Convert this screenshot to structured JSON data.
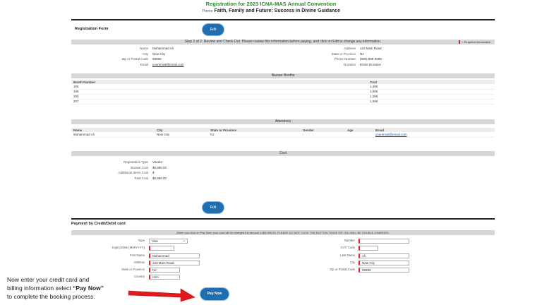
{
  "header": {
    "title": "Registration for 2023 ICNA-MAS Annual Convention",
    "theme_label": "Theme",
    "theme": "Faith, Family and Future: Success in Divine Guidance"
  },
  "form": {
    "title": "Registration Form",
    "edit_label": "Edit",
    "step_text": "Step 2 of 2: Review and Check Out. Please review this information before paying, and click on Edit to change any information.",
    "required_note": "= Required Information",
    "left": [
      {
        "k": "Name",
        "v": "Muhammad Ali"
      },
      {
        "k": "City",
        "v": "New City"
      },
      {
        "k": "Zip or Postal Code",
        "v": "99999"
      },
      {
        "k": "Email",
        "v": "youremail@email.com"
      }
    ],
    "right": [
      {
        "k": "Address",
        "v": "123 Main Road"
      },
      {
        "k": "State or Province",
        "v": "NJ"
      },
      {
        "k": "Phone Number",
        "v": "(999) 999-9999"
      },
      {
        "k": "Duration",
        "v": "Entire Duration"
      }
    ]
  },
  "bazaar": {
    "title": "Bazaar Booths",
    "col_booth": "Booth Number",
    "col_cost": "Cost",
    "rows": [
      {
        "booth": "105",
        "cost": "1,395"
      },
      {
        "booth": "106",
        "cost": "1,595"
      },
      {
        "booth": "205",
        "cost": "1,395"
      },
      {
        "booth": "207",
        "cost": "1,595"
      }
    ]
  },
  "attendees": {
    "title": "Attendees",
    "cols": [
      "Name",
      "City",
      "State or Province",
      "Gender",
      "Age",
      "Email"
    ],
    "rows": [
      {
        "name": "Muhammad Ali",
        "city": "New City",
        "state": "NJ",
        "gender": "",
        "age": "",
        "email": "youremail@email.com"
      }
    ]
  },
  "cost": {
    "title": "Cost",
    "items": [
      {
        "k": "Registration Type",
        "v": "Vendor"
      },
      {
        "k": "Bazaar Cost",
        "v": "$5,980.00"
      },
      {
        "k": "Additional Items Cost",
        "v": "$"
      },
      {
        "k": "Total Cost",
        "v": "$5,980.00"
      }
    ]
  },
  "payment": {
    "title": "Payment by Credit/Debit card",
    "warning": "When you click on Pay Now, your card will be charged the amount of $5,980.00. PLEASE DO NOT CLICK THE BUTTON TWICE OR YOU WILL BE DOUBLE-CHARGED.",
    "type_label": "Type",
    "type_value": "Visa",
    "expiry_label": "Expiry Date (MM/YYYY)",
    "expiry_value": "",
    "first_label": "First Name",
    "first_value": "Muhammad",
    "address_label": "Address",
    "address_value": "123 Main Road",
    "state_label": "State or Province",
    "state_value": "NJ",
    "country_label": "Country",
    "country_value": "USA",
    "number_label": "Number",
    "number_value": "",
    "cvv_label": "CVV Code",
    "cvv_value": "",
    "last_label": "Last Name",
    "last_value": "Ali",
    "city_label": "City",
    "city_value": "New City",
    "zip_label": "Zip or Postal Code",
    "zip_value": "99999",
    "pay_label": "Pay Now"
  },
  "callout": {
    "line1": "Now enter your credit card and",
    "line2_pre": "billing information select ",
    "line2_bold": "“Pay Now”",
    "line3": "to complete the booking process."
  },
  "colors": {
    "accent": "#1f6fb0",
    "title_green": "#2e8b2e",
    "arrow": "#e01a1a",
    "required": "#d22222"
  }
}
